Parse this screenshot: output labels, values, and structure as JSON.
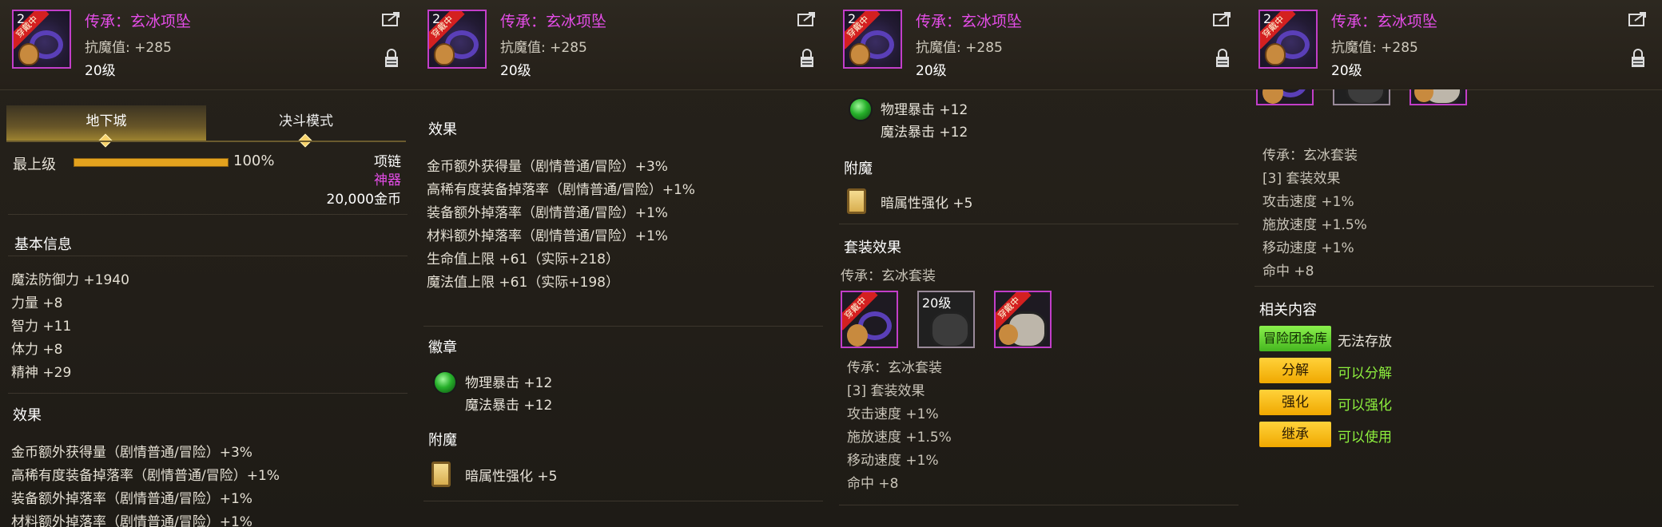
{
  "item": {
    "name": "传承：玄冰项坠",
    "stat": "抗魔值: +285",
    "level": "20级",
    "icon_badge": "穿戴中",
    "icon_num": "2"
  },
  "tabs": [
    "地下城",
    "决斗模式"
  ],
  "upgrade": {
    "label": "最上级",
    "percent": "100%"
  },
  "meta": {
    "type": "项链",
    "rarity": "神器",
    "price": "20,000金币"
  },
  "basic": {
    "title": "基本信息",
    "lines": [
      "魔法防御力 +1940",
      "力量 +8",
      "智力 +11",
      "体力 +8",
      "精神 +29"
    ]
  },
  "effects": {
    "title": "效果",
    "lines": [
      "金币额外获得量（剧情普通/冒险）+3%",
      "高稀有度装备掉落率（剧情普通/冒险）+1%",
      "装备额外掉落率（剧情普通/冒险）+1%",
      "材料额外掉落率（剧情普通/冒险）+1%",
      "生命值上限 +61（实际+218）",
      "魔法值上限 +61（实际+198）"
    ]
  },
  "emblem": {
    "title": "徽章",
    "lines": [
      "物理暴击 +12",
      "魔法暴击 +12"
    ]
  },
  "enchant": {
    "title": "附魔",
    "line": "暗属性强化 +5"
  },
  "set": {
    "title": "套装效果",
    "name": "传承：玄冰套装",
    "piece_level": "20级",
    "lines": [
      "[3] 套装效果",
      "攻击速度 +1%",
      "施放速度 +1.5%",
      "移动速度 +1%",
      "命中 +8"
    ]
  },
  "related": {
    "title": "相关内容",
    "storage_btn": "冒险团金库",
    "storage_text": "无法存放",
    "buttons": [
      {
        "label": "分解",
        "text": "可以分解"
      },
      {
        "label": "强化",
        "text": "可以强化"
      },
      {
        "label": "继承",
        "text": "可以使用"
      }
    ]
  },
  "colors": {
    "title": "#e54de8",
    "rarity": "#e54de8",
    "ok": "#8ef03e",
    "button": "#ffc21a"
  }
}
